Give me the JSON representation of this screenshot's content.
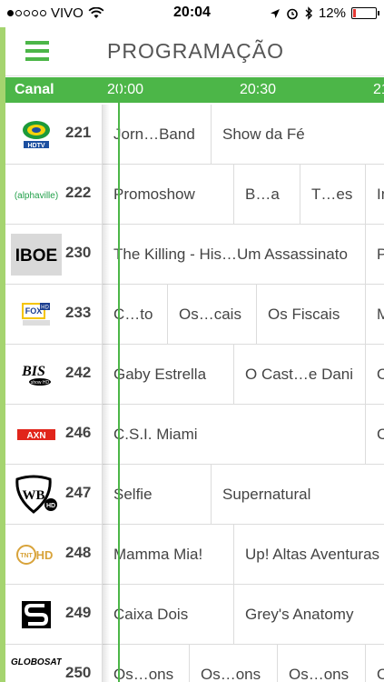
{
  "status_bar": {
    "carrier": "VIVO",
    "time": "20:04",
    "battery": "12%",
    "battery_level": 0.12
  },
  "header": {
    "title": "PROGRAMAÇÃO"
  },
  "timebar": {
    "canal_label": "Canal",
    "times": [
      "20:00",
      "20:30",
      "21"
    ]
  },
  "colors": {
    "accent": "#4cb648",
    "strip": "#a5d46f"
  },
  "channels": [
    {
      "number": "221",
      "logo": "band-hd-logo",
      "programs": [
        "Jorn…Band",
        "Show da Fé"
      ]
    },
    {
      "number": "222",
      "logo": "alphaville-logo",
      "programs": [
        "Promoshow",
        "B…a",
        "T…es",
        "In"
      ]
    },
    {
      "number": "230",
      "logo": "iboe-logo",
      "programs": [
        "The Killing - His…Um Assassinato",
        "P"
      ]
    },
    {
      "number": "233",
      "logo": "fox-natgeo-logo",
      "programs": [
        "C…to",
        "Os…cais",
        "Os Fiscais",
        "M"
      ]
    },
    {
      "number": "242",
      "logo": "bis-show-logo",
      "programs": [
        "Gaby Estrella",
        "O Cast…e Dani",
        "O"
      ]
    },
    {
      "number": "246",
      "logo": "axn-logo",
      "programs": [
        "C.S.I. Miami",
        "C"
      ]
    },
    {
      "number": "247",
      "logo": "warner-logo",
      "programs": [
        "Selfie",
        "Supernatural"
      ]
    },
    {
      "number": "248",
      "logo": "tnt-hd-logo",
      "programs": [
        "Mamma Mia!",
        "Up! Altas Aventuras"
      ]
    },
    {
      "number": "249",
      "logo": "sony-logo",
      "programs": [
        "Caixa Dois",
        "Grey's Anatomy"
      ]
    },
    {
      "number": "250",
      "logo": "globosat-logo",
      "programs": [
        "Os…ons",
        "Os…ons",
        "Os…ons",
        "O"
      ]
    }
  ]
}
